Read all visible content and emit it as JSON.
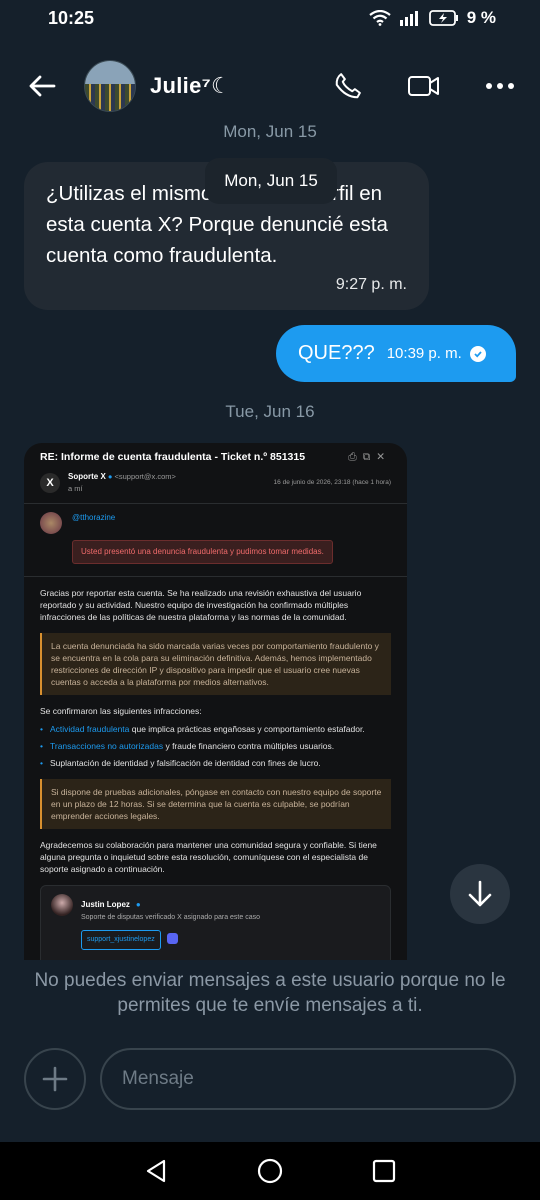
{
  "status_bar": {
    "time": "10:25",
    "battery": "9 %"
  },
  "header": {
    "contact_name": "Julie⁷☾"
  },
  "chat": {
    "date_faded": "Mon, Jun 15",
    "date_pill": "Mon, Jun 15",
    "incoming": {
      "text": "¿Utilizas el mismo nombre y perfil en esta cuenta X? Porque denuncié esta cuenta como fraudulenta.",
      "time": "9:27 p. m."
    },
    "outgoing": {
      "text": "QUE???",
      "time": "10:39 p. m."
    },
    "date_2": "Tue, Jun 16"
  },
  "email": {
    "subject": "RE: Informe de cuenta fraudulenta - Ticket n.º 851315",
    "sender_name": "Soporte X",
    "sender_email": "<support@x.com>",
    "to": "a mí",
    "date": "16 de junio de 2026, 23:18 (hace 1 hora)",
    "handle": "@tthorazine",
    "alert": "Usted presentó una denuncia fraudulenta y pudimos tomar medidas.",
    "para1": "Gracias por reportar esta cuenta. Se ha realizado una revisión exhaustiva del usuario reportado y su actividad. Nuestro equipo de investigación ha confirmado múltiples infracciones de las políticas de nuestra plataforma y las normas de la comunidad.",
    "box1": "La cuenta denunciada ha sido marcada varias veces por comportamiento fraudulento y se encuentra en la cola para su eliminación definitiva. Además, hemos implementado restricciones de dirección IP y dispositivo para impedir que el usuario cree nuevas cuentas o acceda a la plataforma por medios alternativos.",
    "violations_heading": "Se confirmaron las siguientes infracciones:",
    "v1_link": "Actividad fraudulenta",
    "v1_rest": " que implica prácticas engañosas y comportamiento estafador.",
    "v2_link": "Transacciones no autorizadas",
    "v2_rest": " y fraude financiero contra múltiples usuarios.",
    "v3": "Suplantación de identidad y falsificación de identidad con fines de lucro.",
    "box2": "Si dispone de pruebas adicionales, póngase en contacto con nuestro equipo de soporte en un plazo de 12 horas. Si se determina que la cuenta es culpable, se podrían emprender acciones legales.",
    "para2": "Agradecemos su colaboración para mantener una comunidad segura y confiable. Si tiene alguna pregunta o inquietud sobre esta resolución, comuníquese con el especialista de soporte asignado a continuación.",
    "agent_name": "Justin Lopez",
    "agent_role": "Soporte de disputas verificado X asignado para este caso",
    "agent_tag": "support_xjustinelopez"
  },
  "notice": "No puedes enviar mensajes a este usuario porque no le permites que te envíe mensajes a ti.",
  "composer": {
    "placeholder": "Mensaje"
  },
  "colors": {
    "background": "#15202b",
    "accent": "#1d9bf0",
    "bubble_in": "#222a33"
  }
}
